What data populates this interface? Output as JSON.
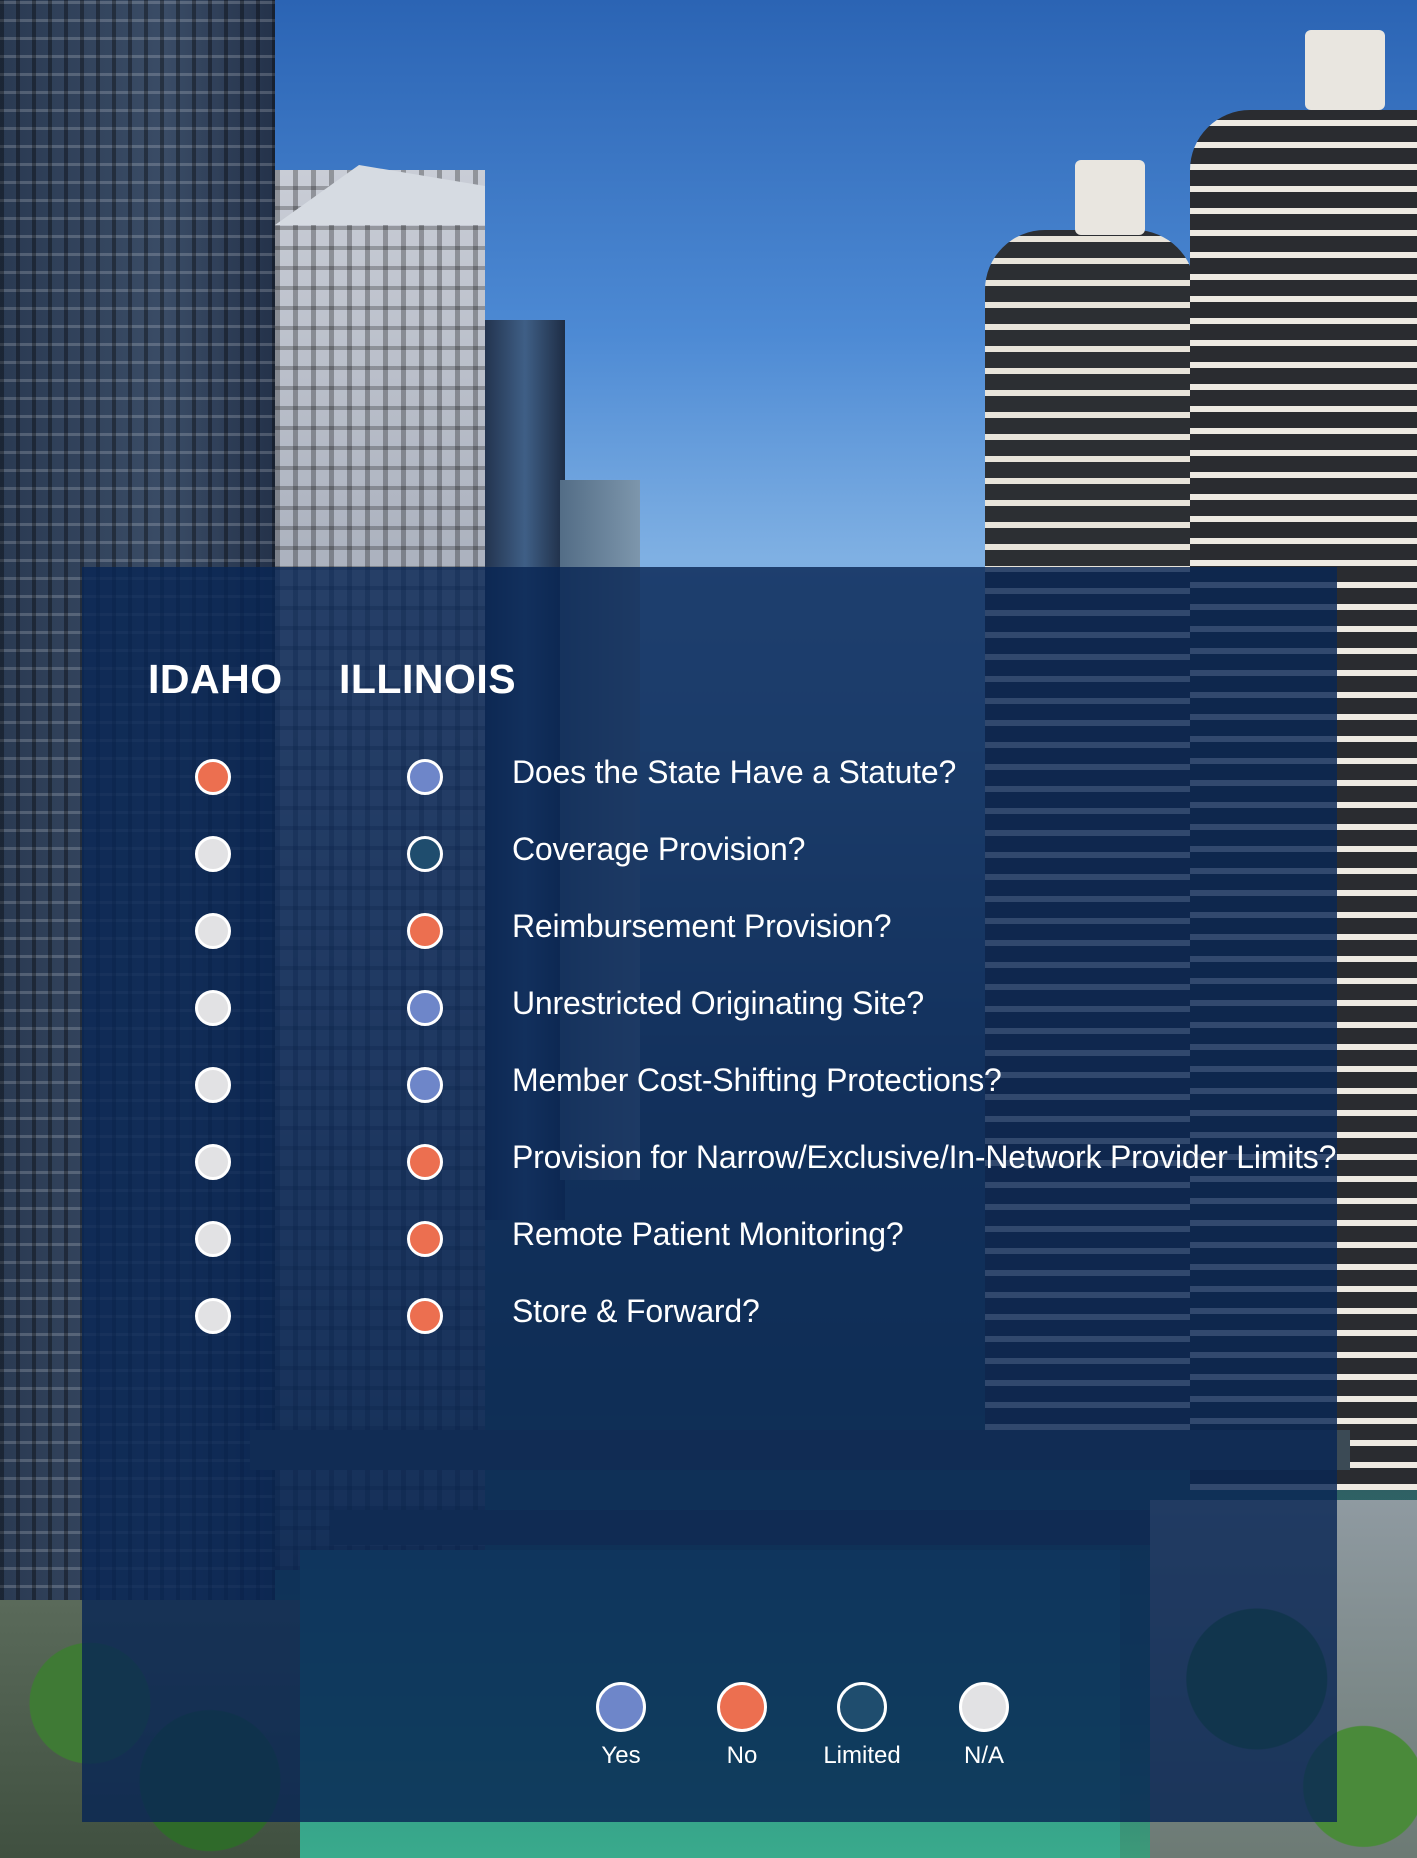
{
  "colors": {
    "yes": "#6e86c9",
    "no": "#ec6f50",
    "limited": "#1f4d6e",
    "na": "#e2e2e4",
    "panel": "#082654"
  },
  "headers": {
    "idaho": "IDAHO",
    "illinois": "ILLINOIS"
  },
  "rows": [
    {
      "question": "Does the State Have a Statute?",
      "idaho": "no",
      "illinois": "yes"
    },
    {
      "question": "Coverage Provision?",
      "idaho": "na",
      "illinois": "limited"
    },
    {
      "question": "Reimbursement Provision?",
      "idaho": "na",
      "illinois": "no"
    },
    {
      "question": "Unrestricted Originating Site?",
      "idaho": "na",
      "illinois": "yes"
    },
    {
      "question": "Member Cost-Shifting Protections?",
      "idaho": "na",
      "illinois": "yes"
    },
    {
      "question": "Provision for Narrow/Exclusive/In-Network Provider Limits?",
      "idaho": "na",
      "illinois": "no"
    },
    {
      "question": "Remote Patient Monitoring?",
      "idaho": "na",
      "illinois": "no"
    },
    {
      "question": "Store & Forward?",
      "idaho": "na",
      "illinois": "no"
    }
  ],
  "legend": [
    {
      "key": "yes",
      "label": "Yes"
    },
    {
      "key": "no",
      "label": "No"
    },
    {
      "key": "limited",
      "label": "Limited"
    },
    {
      "key": "na",
      "label": "N/A"
    }
  ]
}
